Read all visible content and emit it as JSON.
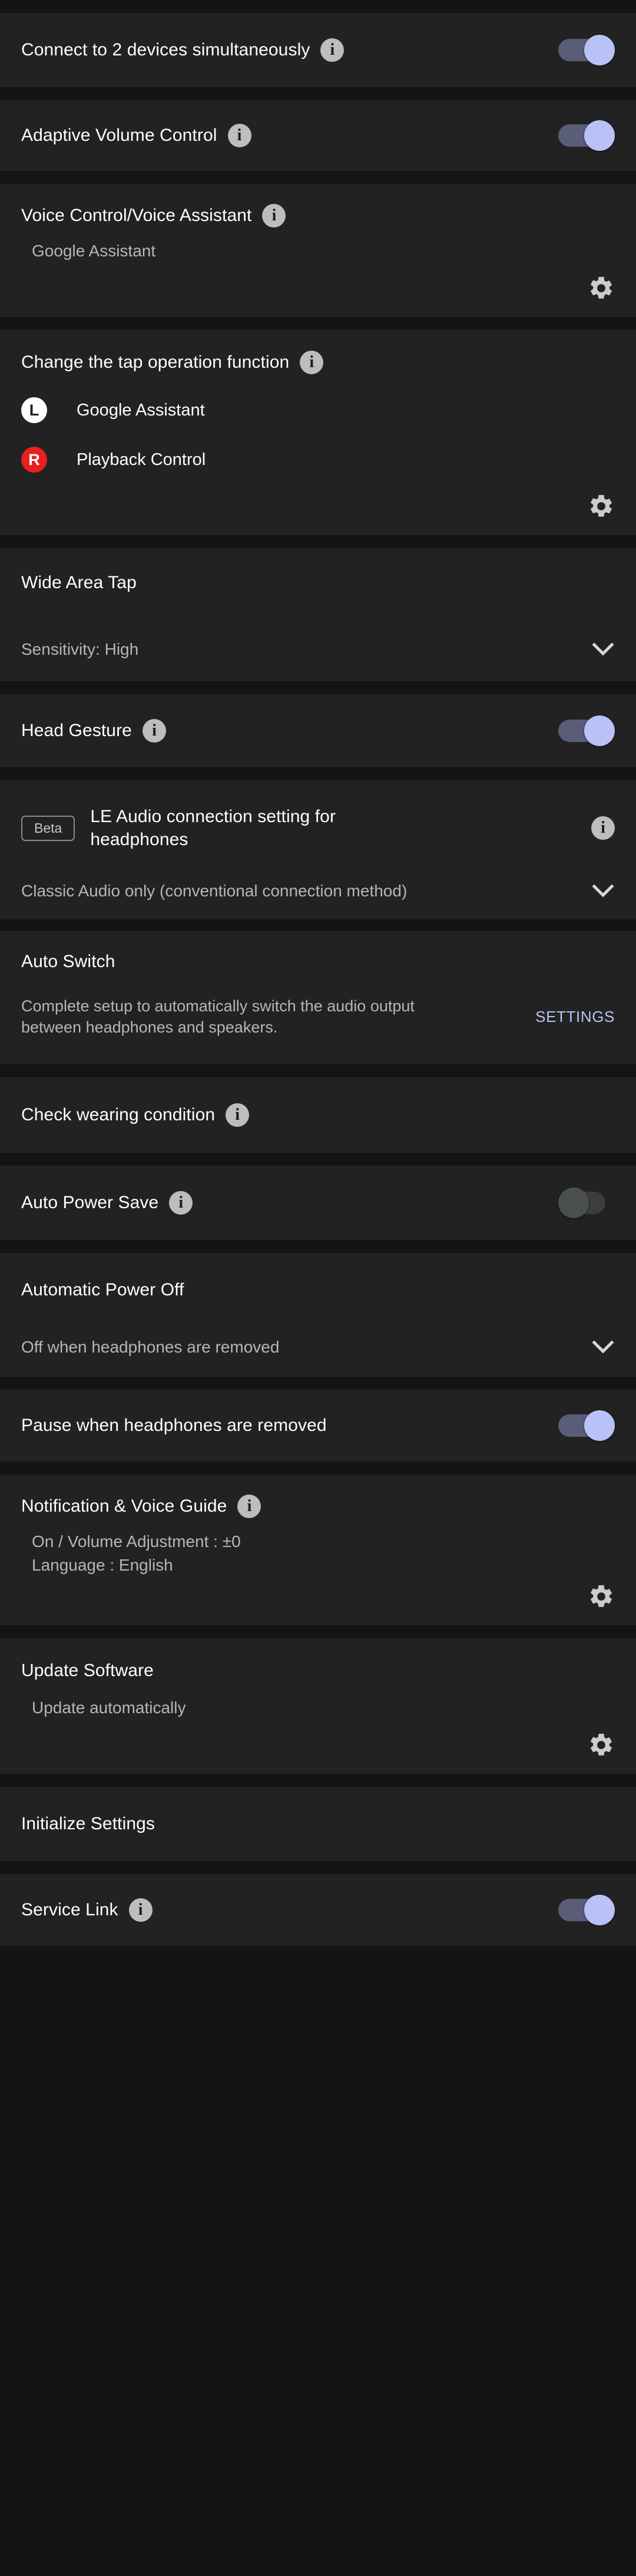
{
  "colors": {
    "card_bg": "#222222",
    "page_bg": "#141414",
    "toggle_on_track": "#5a5d77",
    "toggle_on_thumb": "#b9c2f7",
    "toggle_off_track": "#3b3e3f",
    "toggle_off_thumb": "#4c4f50",
    "info_icon": "#bdbdbd",
    "link": "#b9c2f7",
    "badge_right": "#e8201e",
    "badge_left": "#ffffff"
  },
  "icons": {
    "info": "info-icon",
    "gear": "gear-icon",
    "chevron_down": "chevron-down-icon"
  },
  "sections": {
    "multipoint": {
      "title": "Connect to 2 devices simultaneously",
      "toggle_state": "on"
    },
    "adaptive_volume": {
      "title": "Adaptive Volume Control",
      "toggle_state": "on"
    },
    "voice_assistant": {
      "title": "Voice Control/Voice Assistant",
      "value": "Google Assistant"
    },
    "tap_operation": {
      "title": "Change the tap operation function",
      "assignments": [
        {
          "side": "L",
          "function": "Google Assistant"
        },
        {
          "side": "R",
          "function": "Playback Control"
        }
      ]
    },
    "wide_area_tap": {
      "title": "Wide Area Tap",
      "value": "Sensitivity: High"
    },
    "head_gesture": {
      "title": "Head Gesture",
      "toggle_state": "on"
    },
    "le_audio": {
      "badge": "Beta",
      "title": "LE Audio connection setting for headphones",
      "value": "Classic Audio only (conventional connection method)"
    },
    "auto_switch": {
      "title": "Auto Switch",
      "description": "Complete setup to automatically switch the audio output between headphones and speakers.",
      "action_label": "SETTINGS"
    },
    "check_wearing": {
      "title": "Check wearing condition"
    },
    "auto_power_save": {
      "title": "Auto Power Save",
      "toggle_state": "off"
    },
    "automatic_power_off": {
      "title": "Automatic Power Off",
      "value": "Off when headphones are removed"
    },
    "pause_when_removed": {
      "title": "Pause when headphones are removed",
      "toggle_state": "on"
    },
    "notification_voice_guide": {
      "title": "Notification & Voice Guide",
      "value_line1": "On / Volume Adjustment : ±0",
      "value_line2": "Language : English"
    },
    "update_software": {
      "title": "Update Software",
      "value": "Update automatically"
    },
    "initialize_settings": {
      "title": "Initialize Settings"
    },
    "service_link": {
      "title": "Service Link",
      "toggle_state": "on"
    }
  }
}
